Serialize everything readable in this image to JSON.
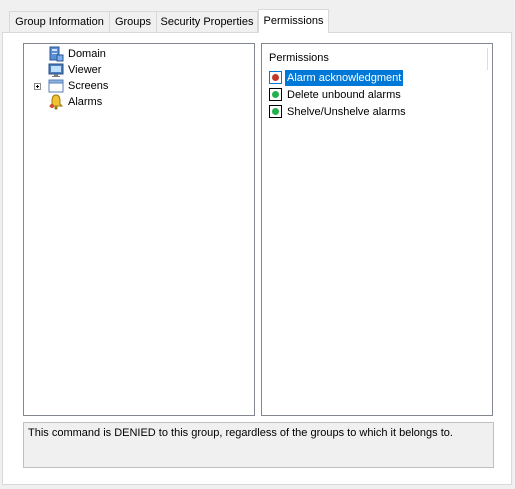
{
  "tabs": [
    {
      "label": "Group Information",
      "active": false
    },
    {
      "label": "Groups",
      "active": false
    },
    {
      "label": "Security Properties",
      "active": false
    },
    {
      "label": "Permissions",
      "active": true
    }
  ],
  "tree": {
    "items": [
      {
        "label": "Domain",
        "icon": "domain-icon"
      },
      {
        "label": "Viewer",
        "icon": "viewer-icon"
      },
      {
        "label": "Screens",
        "icon": "screens-icon",
        "expandable": true
      },
      {
        "label": "Alarms",
        "icon": "alarms-icon"
      }
    ]
  },
  "permissions": {
    "header": "Permissions",
    "items": [
      {
        "label": "Alarm acknowledgment",
        "state": "denied",
        "selected": true
      },
      {
        "label": "Delete unbound alarms",
        "state": "allowed",
        "selected": false
      },
      {
        "label": "Shelve/Unshelve alarms",
        "state": "allowed",
        "selected": false
      }
    ],
    "colors": {
      "denied": "#c0392b",
      "allowed": "#22b14c",
      "selection": "#0078d7"
    }
  },
  "description": "This command is DENIED to this group, regardless of the groups to which it belongs to."
}
